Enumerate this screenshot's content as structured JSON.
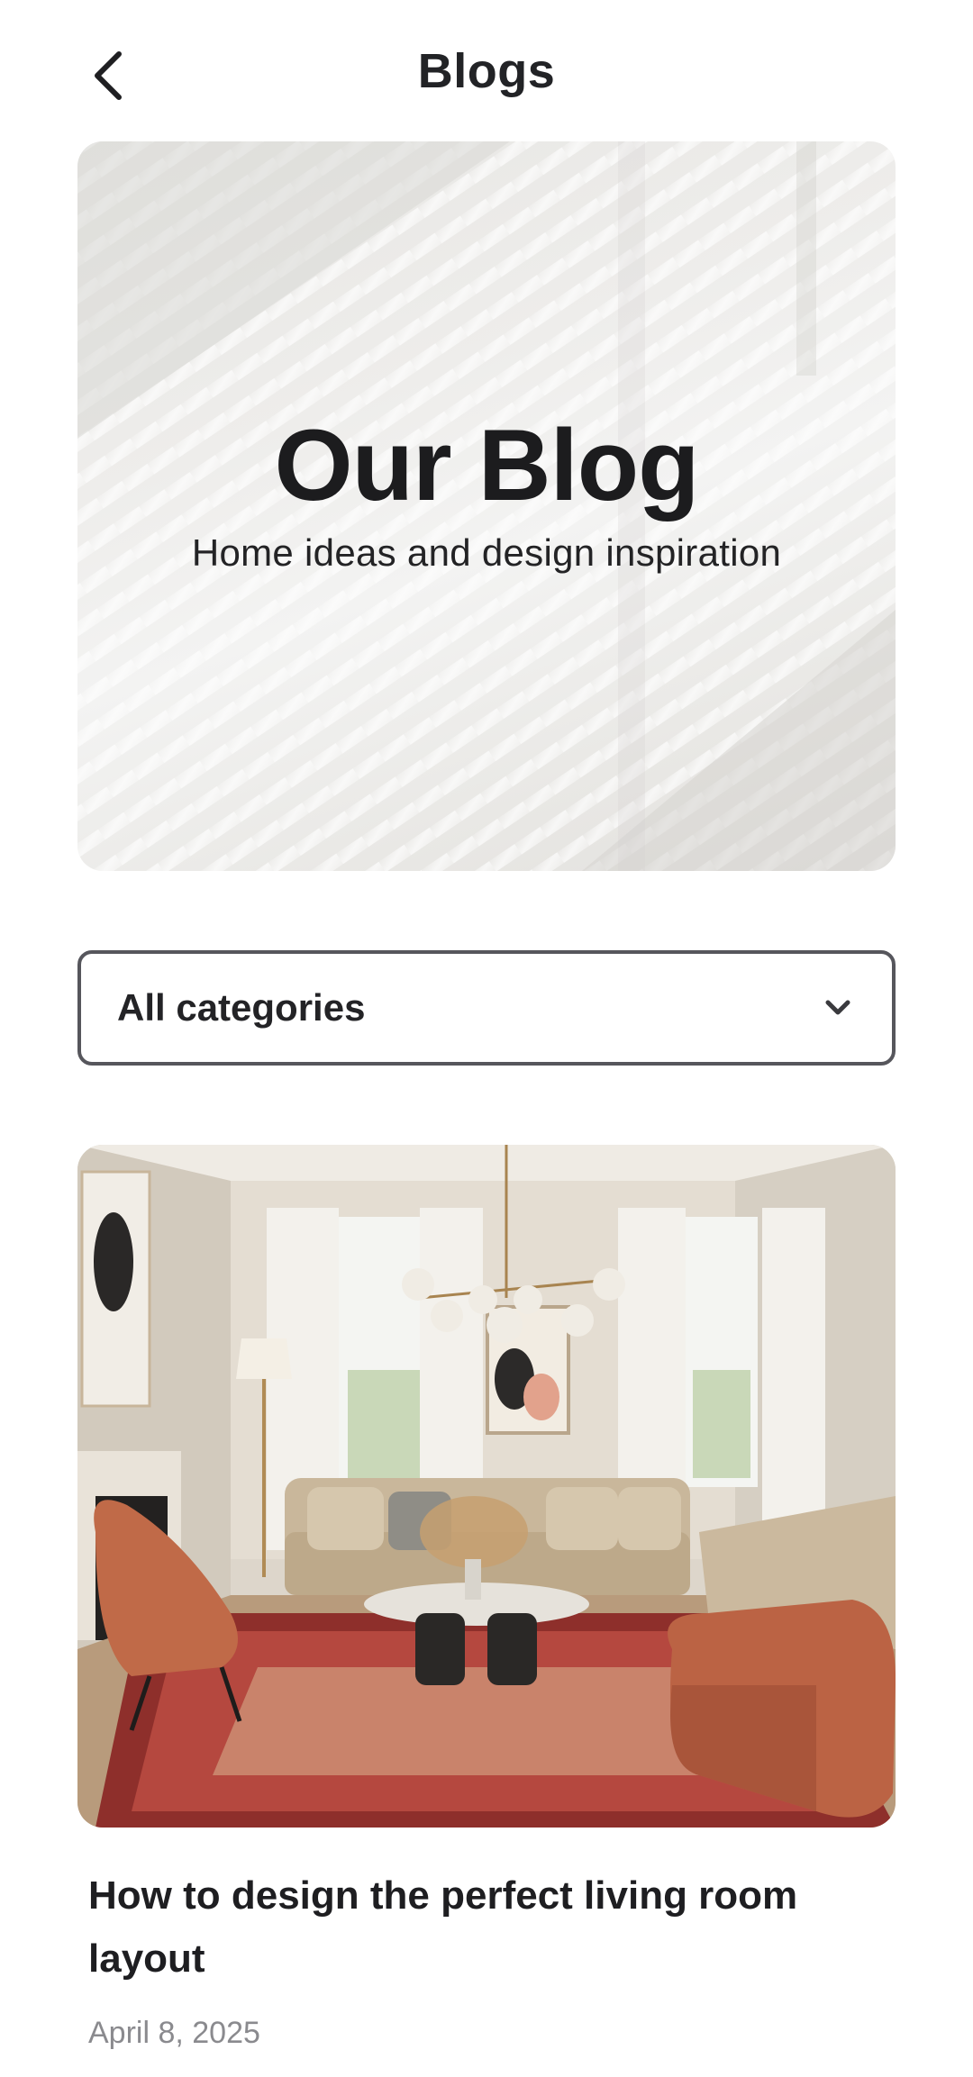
{
  "header": {
    "title": "Blogs",
    "back_icon": "chevron-left-icon"
  },
  "hero": {
    "title": "Our Blog",
    "subtitle": "Home ideas and design inspiration"
  },
  "category_filter": {
    "selected": "All categories",
    "icon": "chevron-down-icon"
  },
  "posts": [
    {
      "title": "How to design the perfect living room layout",
      "date": "April 8, 2025"
    }
  ],
  "colors": {
    "text_primary": "#1f1f22",
    "text_secondary": "#8a8a8e",
    "border": "#56565c",
    "sofa": "#c9b79b",
    "chair": "#c06a48",
    "rug": "#8e2f2b"
  }
}
